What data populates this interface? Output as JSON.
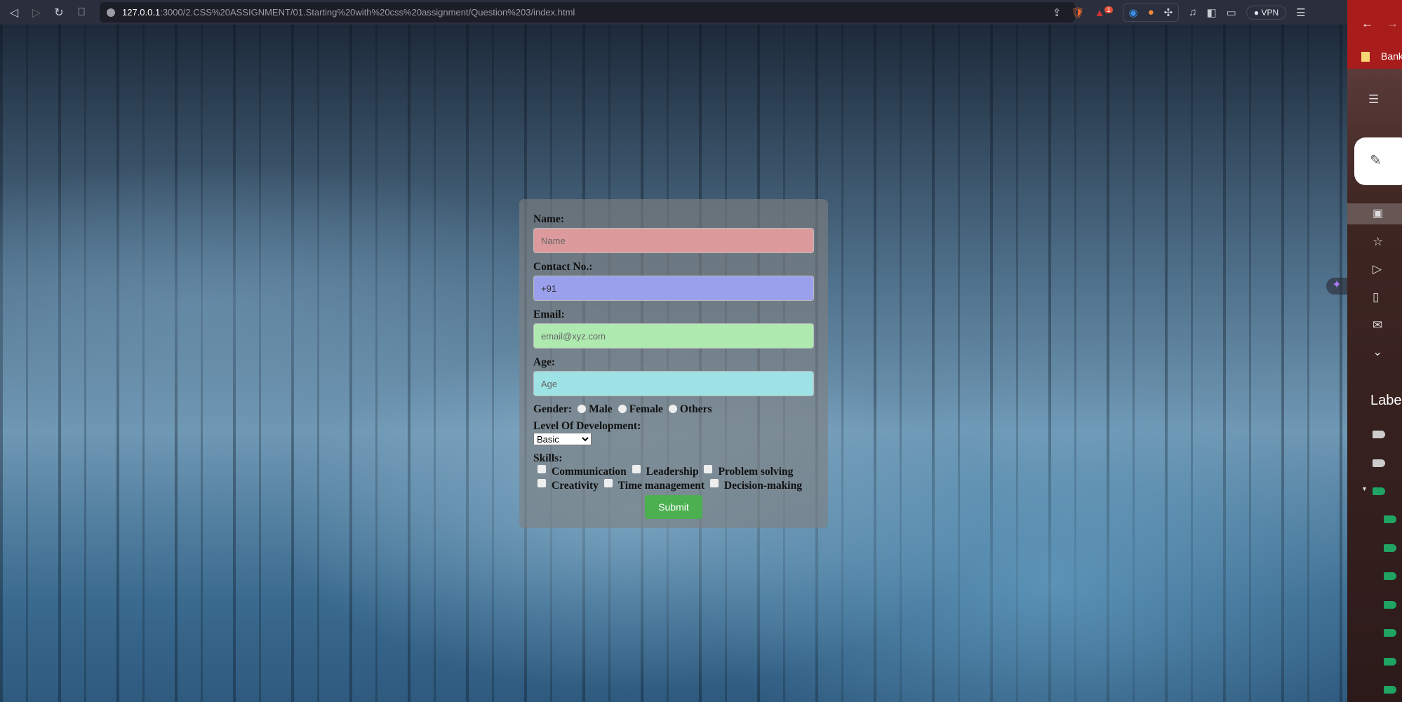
{
  "browser": {
    "url_host": "127.0.0.1",
    "url_rest": ":3000/2.CSS%20ASSIGNMENT/01.Starting%20with%20css%20assignment/Question%203/index.html",
    "vpn_label": "VPN",
    "badge_count": "1"
  },
  "form": {
    "name_label": "Name:",
    "name_placeholder": "Name",
    "contact_label": "Contact No.:",
    "contact_value": "+91",
    "email_label": "Email:",
    "email_placeholder": "email@xyz.com",
    "age_label": "Age:",
    "age_placeholder": "Age",
    "gender_label": "Gender:",
    "gender_options": [
      "Male",
      "Female",
      "Others"
    ],
    "level_label": "Level Of Development:",
    "level_selected": "Basic",
    "skills_label": "Skills:",
    "skills": [
      "Communication",
      "Leadership",
      "Problem solving",
      "Creativity",
      "Time management",
      "Decision-making"
    ],
    "submit_label": "Submit",
    "colors": {
      "name": "#dc9a9c",
      "contact": "#9ba0ec",
      "email": "#aeeab0",
      "age": "#9de2e5",
      "submit": "#4caf50"
    }
  },
  "gmail": {
    "bookmark": "Bank",
    "labels_heading": "Labe"
  }
}
